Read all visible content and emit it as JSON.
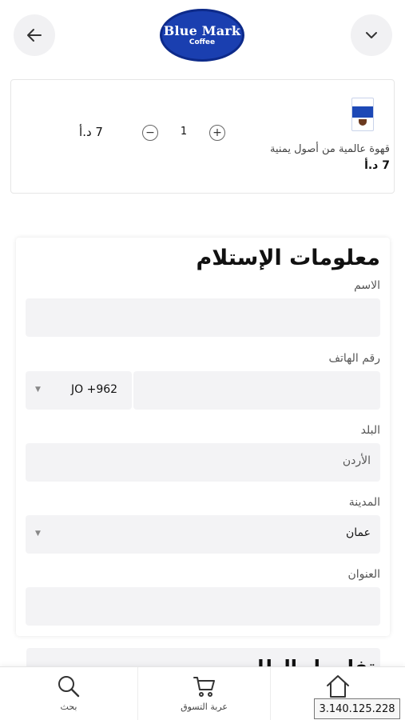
{
  "header": {
    "logo_title": "Blue Mark",
    "logo_subtitle": "Coffee",
    "back_icon": "arrow-left-icon",
    "menu_icon": "chevron-down-icon"
  },
  "cart": {
    "item": {
      "name": "قهوة عالمية من أصول يمنية",
      "price": "7 د.أ",
      "quantity": "1",
      "line_total": "7 د.أ",
      "plus_label": "+",
      "minus_label": "−"
    }
  },
  "form": {
    "title": "معلومات الإستلام",
    "name_label": "الاسم",
    "phone_label": "رقم الهاتف",
    "phone_code": "JO +962",
    "country_label": "البلد",
    "country_value": "الأردن",
    "city_label": "المدينة",
    "city_value": "عمان",
    "address_label": "العنوان"
  },
  "next_section": {
    "title": "تفاصيل الطلب"
  },
  "bottom_nav": {
    "search_label": "بحث",
    "cart_label": "عربة التسوق"
  },
  "ip_badge": "3.140.125.228",
  "colors": {
    "brand_blue": "#1a3fb0",
    "field_bg": "#f3f3f5"
  }
}
